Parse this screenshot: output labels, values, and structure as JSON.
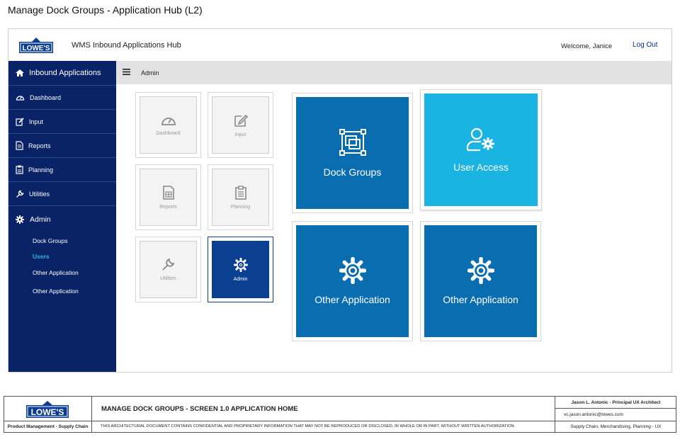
{
  "document": {
    "title": "Manage Dock Groups - Application Hub (L2)"
  },
  "brand": {
    "logo_text": "LOWE'S",
    "primary": "#0a2366",
    "accent": "#1ab4e3",
    "tile_blue": "#0a6db0"
  },
  "header": {
    "hub_title": "WMS Inbound Applications Hub",
    "welcome": "Welcome, Janice",
    "logout": "Log Out"
  },
  "sidebar": {
    "header": {
      "label": "Inbound Applications",
      "icon": "home-icon"
    },
    "items": [
      {
        "label": "Dashboard",
        "icon": "dashboard-icon"
      },
      {
        "label": "Input",
        "icon": "edit-icon"
      },
      {
        "label": "Reports",
        "icon": "report-icon"
      },
      {
        "label": "Planning",
        "icon": "clipboard-icon"
      },
      {
        "label": "Utilities",
        "icon": "wrench-icon"
      }
    ],
    "admin": {
      "label": "Admin",
      "icon": "gear-icon"
    },
    "sub_items": [
      {
        "label": "Dock Groups",
        "active": false
      },
      {
        "label": "Users",
        "active": true
      },
      {
        "label": "Other Application",
        "active": false
      },
      {
        "label": "Other Application",
        "active": false
      }
    ]
  },
  "breadcrumb": {
    "current": "Admin"
  },
  "small_tiles": [
    {
      "label": "Dashboard",
      "icon": "dashboard-icon",
      "active": false
    },
    {
      "label": "Input",
      "icon": "edit-icon",
      "active": false
    },
    {
      "label": "Reports",
      "icon": "report-icon",
      "active": false
    },
    {
      "label": "Planning",
      "icon": "clipboard-icon",
      "active": false
    },
    {
      "label": "Utilities",
      "icon": "wrench-icon",
      "active": false
    },
    {
      "label": "Admin",
      "icon": "gear-icon",
      "active": true
    }
  ],
  "big_tiles": [
    {
      "label": "Dock Groups",
      "icon": "dock-groups-icon",
      "color": "#0a6db0"
    },
    {
      "label": "User Access",
      "icon": "user-settings-icon",
      "color": "#1ab4e3"
    },
    {
      "label": "Other Application",
      "icon": "gear-icon",
      "color": "#0a6db0"
    },
    {
      "label": "Other Application",
      "icon": "gear-icon",
      "color": "#0a6db0"
    }
  ],
  "footer": {
    "title": "MANAGE DOCK GROUPS - SCREEN 1.0 APPLICATION HOME",
    "author": "Jason L. Antonic - Principal UX Architect",
    "email": "vc.jason.antonic@lowes.com",
    "left_label": "Product Management - Supply Chain",
    "confidential": "THIS ARCHITECTURAL DOCUMENT CONTAINS CONFIDENTIAL AND PROPRIETARY INFORMATION THAT MAY NOT BE REPRODUCED OR DISCLOSED, IN WHOLE OR IN PART, WITHOUT WRITTEN AUTHORIZATION",
    "dept": "Supply Chain, Merchandising, Planning - UX"
  }
}
